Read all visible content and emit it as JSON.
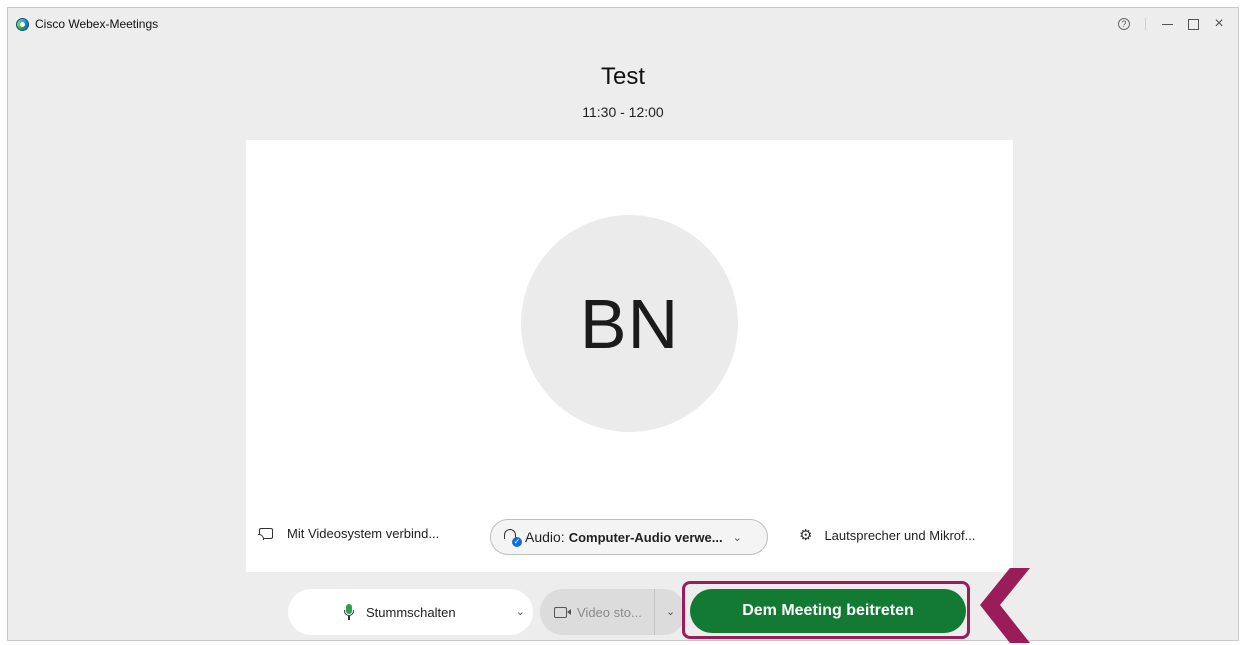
{
  "app": {
    "title": "Cisco Webex-Meetings"
  },
  "window_controls": {
    "help": "?",
    "close": "×"
  },
  "meeting": {
    "title": "Test",
    "time": "11:30 - 12:00"
  },
  "avatar": {
    "initials": "BN"
  },
  "options": {
    "video_system": "Mit Videosystem verbind...",
    "audio_label": "Audio:",
    "audio_value": "Computer-Audio verwe...",
    "speaker_mic": "Lautsprecher und Mikrof..."
  },
  "actions": {
    "mute": "Stummschalten",
    "video": "Video sto...",
    "join": "Dem Meeting beitreten"
  },
  "colors": {
    "join_button": "#137a34",
    "highlight": "#9a1d5a",
    "mic_active": "#2aa14a",
    "audio_badge": "#1170cf"
  },
  "icons": [
    "app-logo-icon",
    "help-icon",
    "minimize-icon",
    "maximize-icon",
    "close-icon",
    "cast-icon",
    "headset-icon",
    "gear-icon",
    "microphone-icon",
    "camera-icon",
    "chevron-down-icon",
    "callout-arrow-icon"
  ]
}
